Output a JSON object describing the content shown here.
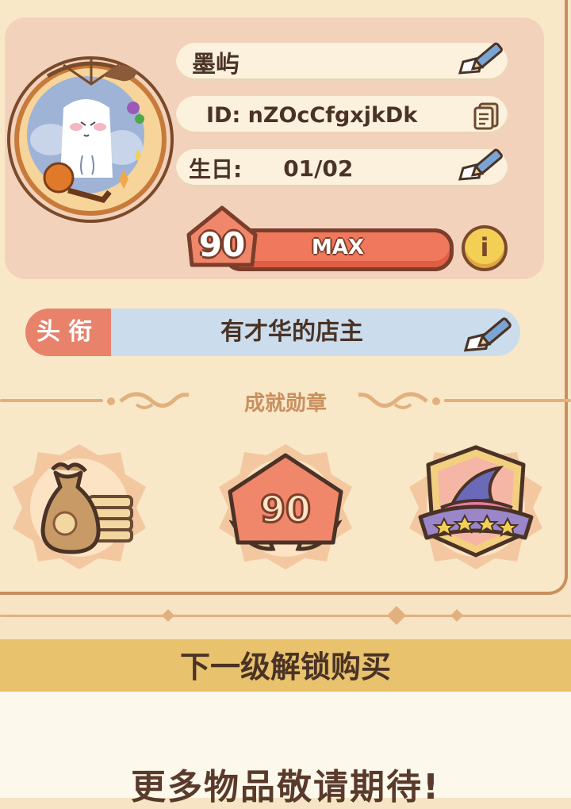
{
  "profile": {
    "name": "墨屿",
    "id_text": "ID: nZOcCfgxjkDk",
    "birthday_label": "生日:",
    "birthday_value": "01/02",
    "level": "90",
    "level_status": "MAX",
    "info_symbol": "i"
  },
  "title": {
    "tag": "头衔",
    "value": "有才华的店主"
  },
  "achievements": {
    "heading": "成就勋章",
    "badges": [
      {
        "icon": "money-bag-icon"
      },
      {
        "icon": "level-90-icon",
        "label": "90"
      },
      {
        "icon": "witch-hat-stars-icon"
      }
    ]
  },
  "unlock": {
    "header": "下一级解锁购买",
    "message": "更多物品敬请期待!"
  },
  "colors": {
    "background": "#f6e4c4",
    "panel": "#f3d2bc",
    "level_bar": "#f0785c",
    "title_tag": "#e8826a",
    "title_bar": "#cbdcec",
    "unlock_header": "#e8c26c"
  }
}
